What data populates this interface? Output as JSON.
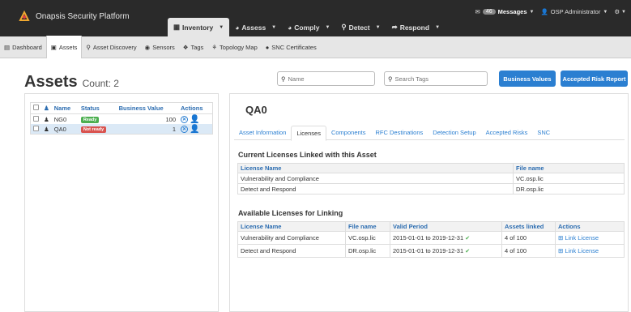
{
  "topbar": {
    "brand": "Onapsis Security Platform",
    "nav": [
      {
        "label": "Inventory",
        "icon": "grid-icon",
        "active": true
      },
      {
        "label": "Assess",
        "icon": "gauge-icon"
      },
      {
        "label": "Comply",
        "icon": "gauge-icon"
      },
      {
        "label": "Detect",
        "icon": "search-icon"
      },
      {
        "label": "Respond",
        "icon": "arrow-icon"
      }
    ],
    "messages_count": "46",
    "messages_label": "Messages",
    "user": "OSP Administrator"
  },
  "subnav": [
    {
      "label": "Dashboard"
    },
    {
      "label": "Assets",
      "active": true
    },
    {
      "label": "Asset Discovery"
    },
    {
      "label": "Sensors"
    },
    {
      "label": "Tags"
    },
    {
      "label": "Topology Map"
    },
    {
      "label": "SNC Certificates"
    }
  ],
  "page": {
    "title": "Assets",
    "count": "Count: 2",
    "name_placeholder": "Name",
    "tags_placeholder": "Search Tags",
    "btn_business": "Business Values",
    "btn_accepted": "Accepted Risk Report"
  },
  "assets": {
    "headers": [
      "Name",
      "Status",
      "Business Value",
      "Actions"
    ],
    "rows": [
      {
        "name": "NG0",
        "status": "Ready",
        "value": "100"
      },
      {
        "name": "QA0",
        "status": "Not ready",
        "value": "1"
      }
    ]
  },
  "detail": {
    "title": "QA0",
    "tabs": [
      "Asset Information",
      "Licenses",
      "Components",
      "RFC Destinations",
      "Detection Setup",
      "Accepted Risks",
      "SNC"
    ],
    "current_title": "Current Licenses Linked with this Asset",
    "current_headers": [
      "License Name",
      "File name"
    ],
    "current_rows": [
      [
        "Vulnerability and Compliance",
        "VC.osp.lic"
      ],
      [
        "Detect and Respond",
        "DR.osp.lic"
      ]
    ],
    "available_title": "Available Licenses for Linking",
    "available_headers": [
      "License Name",
      "File name",
      "Valid Period",
      "Assets linked",
      "Actions"
    ],
    "available_rows": [
      [
        "Vulnerability and Compliance",
        "VC.osp.lic",
        "2015-01-01 to 2019-12-31",
        "4 of 100",
        "Link License"
      ],
      [
        "Detect and Respond",
        "DR.osp.lic",
        "2015-01-01 to 2019-12-31",
        "4 of 100",
        "Link License"
      ]
    ]
  }
}
